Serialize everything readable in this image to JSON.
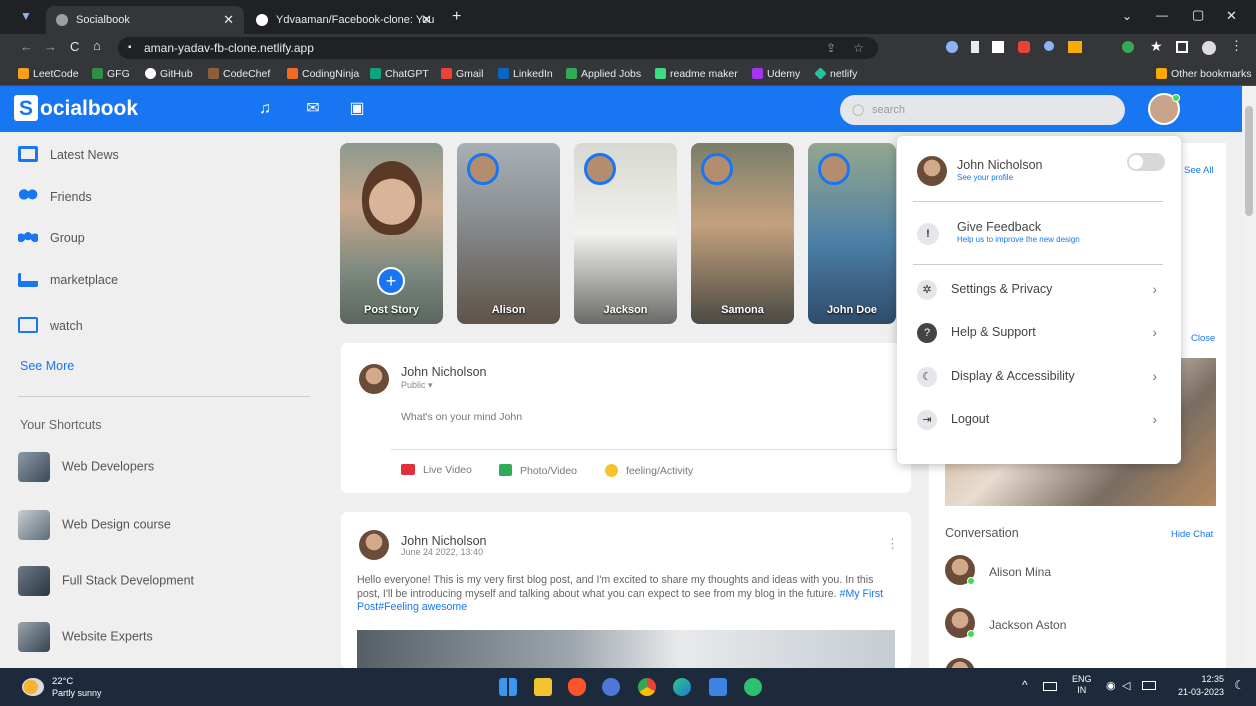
{
  "browser": {
    "tabs": [
      {
        "title": "Socialbook",
        "active": false
      },
      {
        "title": "Ydvaaman/Facebook-clone: You",
        "active": true
      }
    ],
    "new_tab": "+",
    "url": "aman-yadav-fb-clone.netlify.app",
    "window_controls": [
      "⌄",
      "—",
      "▢",
      "✕"
    ],
    "bookmarks": [
      {
        "label": "LeetCode",
        "color": "#f89f1b"
      },
      {
        "label": "GFG",
        "color": "#2f8d46"
      },
      {
        "label": "GitHub",
        "color": "#ffffff"
      },
      {
        "label": "CodeChef",
        "color": "#8b5e3c"
      },
      {
        "label": "CodingNinja",
        "color": "#f26b21"
      },
      {
        "label": "ChatGPT",
        "color": "#10a37f"
      },
      {
        "label": "Gmail",
        "color": "#ea4335"
      },
      {
        "label": "LinkedIn",
        "color": "#0a66c2"
      },
      {
        "label": "Applied Jobs",
        "color": "#34a853"
      },
      {
        "label": "readme maker",
        "color": "#3ddc84"
      },
      {
        "label": "Udemy",
        "color": "#a435f0"
      },
      {
        "label": "netlify",
        "color": "#25c2a0"
      }
    ],
    "other_bookmarks": "Other bookmarks"
  },
  "app": {
    "logo_letter": "S",
    "logo_rest": "ocialbook",
    "accent": "#1876f2",
    "header_icons": [
      "bell-icon",
      "mail-icon",
      "video-icon"
    ],
    "search_placeholder": "search"
  },
  "sidebar": {
    "items": [
      {
        "label": "Latest News",
        "icon": "news-icon",
        "color": "#1876f2"
      },
      {
        "label": "Friends",
        "icon": "friends-icon",
        "color": "#1876f2"
      },
      {
        "label": "Group",
        "icon": "group-icon",
        "color": "#1876f2"
      },
      {
        "label": "marketplace",
        "icon": "cart-icon",
        "color": "#1876f2"
      },
      {
        "label": "watch",
        "icon": "watch-icon",
        "color": "#1876f2"
      }
    ],
    "see_more": "See More",
    "shortcuts_title": "Your Shortcuts",
    "shortcuts": [
      "Web Developers",
      "Web Design course",
      "Full Stack Development",
      "Website Experts"
    ]
  },
  "stories": [
    {
      "name": "Post Story",
      "is_post": true
    },
    {
      "name": "Alison"
    },
    {
      "name": "Jackson"
    },
    {
      "name": "Samona"
    },
    {
      "name": "John Doe"
    }
  ],
  "composer": {
    "user": "John Nicholson",
    "privacy": "Public ▾",
    "placeholder": "What's on your mind John",
    "actions": [
      "Live Video",
      "Photo/Video",
      "feeling/Activity"
    ]
  },
  "post": {
    "user": "John Nicholson",
    "date": "June 24 2022, 13:40",
    "text": "Hello everyone! This is my very first blog post, and I'm excited to share my thoughts and ideas with you. In this post, I'll be introducing myself and talking about what you can expect to see from my blog in the future.",
    "hashtags": "#My First Post#Feeling awesome",
    "more": "⋮"
  },
  "right": {
    "see_all": "See All",
    "close": "Close",
    "conversation_title": "Conversation",
    "hide_chat": "Hide Chat",
    "contacts": [
      "Alison Mina",
      "Jackson Aston"
    ]
  },
  "menu": {
    "profile_name": "John Nicholson",
    "profile_sub": "See your profile",
    "feedback_title": "Give Feedback",
    "feedback_sub": "Help us to improve the new design",
    "items": [
      {
        "label": "Settings & Privacy",
        "icon": "gear-icon"
      },
      {
        "label": "Help & Support",
        "icon": "help-icon"
      },
      {
        "label": "Display & Accessibility",
        "icon": "moon-icon"
      },
      {
        "label": "Logout",
        "icon": "logout-icon"
      }
    ],
    "dark_mode_on": false
  },
  "taskbar": {
    "temp": "22°C",
    "weather": "Partly sunny",
    "lang1": "ENG",
    "lang2": "IN",
    "time": "12:35",
    "date": "21-03-2023"
  }
}
